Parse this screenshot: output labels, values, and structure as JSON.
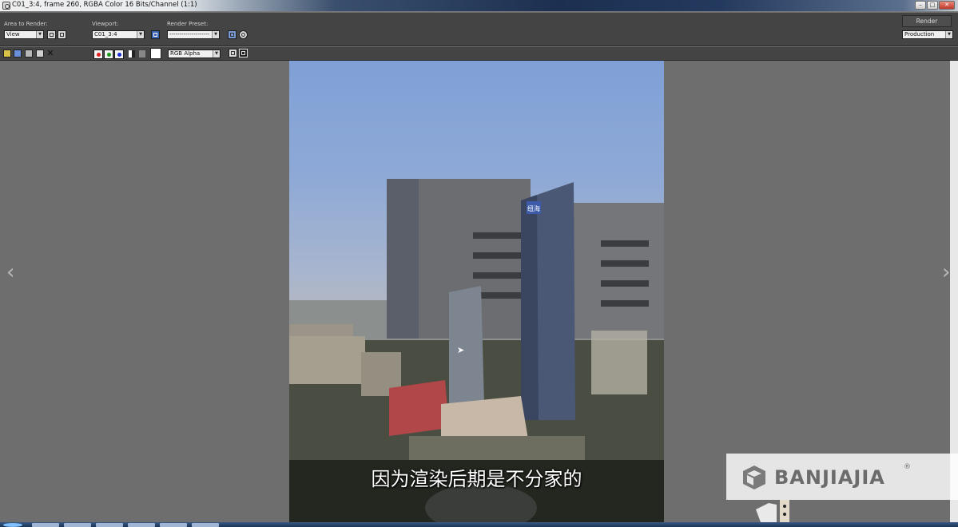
{
  "window": {
    "title": "C01_3:4, frame 260, RGBA Color 16 Bits/Channel (1:1)",
    "controls": [
      "–",
      "□",
      "✕"
    ]
  },
  "toolbar": {
    "area_to_render": {
      "label": "Area to Render:",
      "value": "View"
    },
    "viewport": {
      "label": "Viewport:",
      "value": "C01_3:4"
    },
    "render_preset": {
      "label": "Render Preset:",
      "value": "--------------------"
    },
    "render_button": "Render",
    "render_mode": "Production"
  },
  "channel_bar": {
    "channels": [
      {
        "name": "red",
        "color": "#e02020"
      },
      {
        "name": "green",
        "color": "#1a9a1a"
      },
      {
        "name": "blue",
        "color": "#1a2fd0"
      }
    ],
    "display_channel": "RGB Alpha"
  },
  "viewer": {
    "building_sign": "纽海",
    "subtitle": "因为渲染后期是不分家的"
  },
  "watermark": {
    "brand": "BANJIAJIA",
    "reg_mark": "®"
  },
  "colors": {
    "panel": "#444444",
    "background": "#6e6e6e",
    "sky_top": "#7fa0d6"
  }
}
